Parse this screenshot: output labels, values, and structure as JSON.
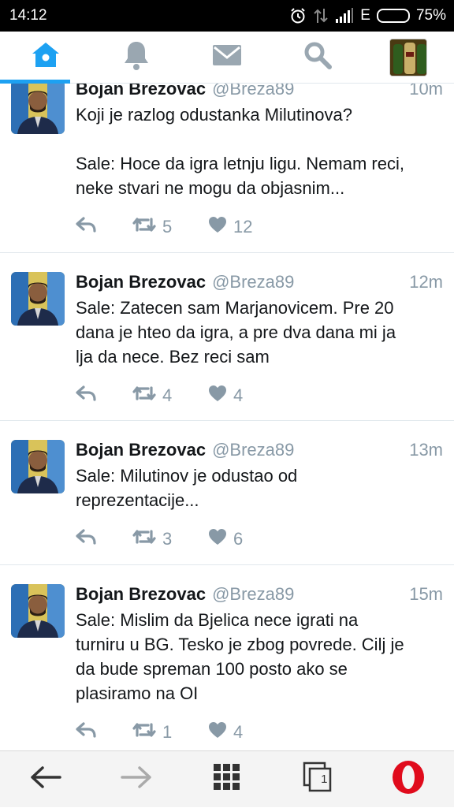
{
  "status_bar": {
    "time": "14:12",
    "network_label": "E",
    "battery_percent": "75%",
    "battery_level": 0.75
  },
  "tabs": [
    {
      "name": "home",
      "icon": "home-icon",
      "active": true
    },
    {
      "name": "notifications",
      "icon": "bell-icon",
      "active": false
    },
    {
      "name": "messages",
      "icon": "envelope-icon",
      "active": false
    },
    {
      "name": "search",
      "icon": "search-icon",
      "active": false
    },
    {
      "name": "profile",
      "icon": "profile-avatar",
      "active": false
    }
  ],
  "accent_color": "#1da1f2",
  "tweets": [
    {
      "name": "Bojan Brezovac",
      "handle": "@Breza89",
      "time": "10m",
      "text": "Koji je razlog odustanka Milutinova?\n\nSale: Hoce da igra letnju ligu. Nemam reci,\nneke stvari ne mogu da objasnim...",
      "retweets": "5",
      "likes": "12"
    },
    {
      "name": "Bojan Brezovac",
      "handle": "@Breza89",
      "time": "12m",
      "text": "Sale: Zatecen sam Marjanovicem. Pre 20\ndana je hteo da igra, a pre dva dana mi ja\nlja da nece. Bez reci sam",
      "retweets": "4",
      "likes": "4"
    },
    {
      "name": "Bojan Brezovac",
      "handle": "@Breza89",
      "time": "13m",
      "text": "Sale: Milutinov je odustao od\nreprezentacije...",
      "retweets": "3",
      "likes": "6"
    },
    {
      "name": "Bojan Brezovac",
      "handle": "@Breza89",
      "time": "15m",
      "text": "Sale: Mislim da Bjelica nece igrati na\nturniru u BG. Tesko je zbog povrede. Cilj je\nda bude spreman 100 posto ako se\nplasiramo na OI",
      "retweets": "1",
      "likes": "4"
    }
  ],
  "bottom_bar": {
    "tab_count": "1"
  }
}
